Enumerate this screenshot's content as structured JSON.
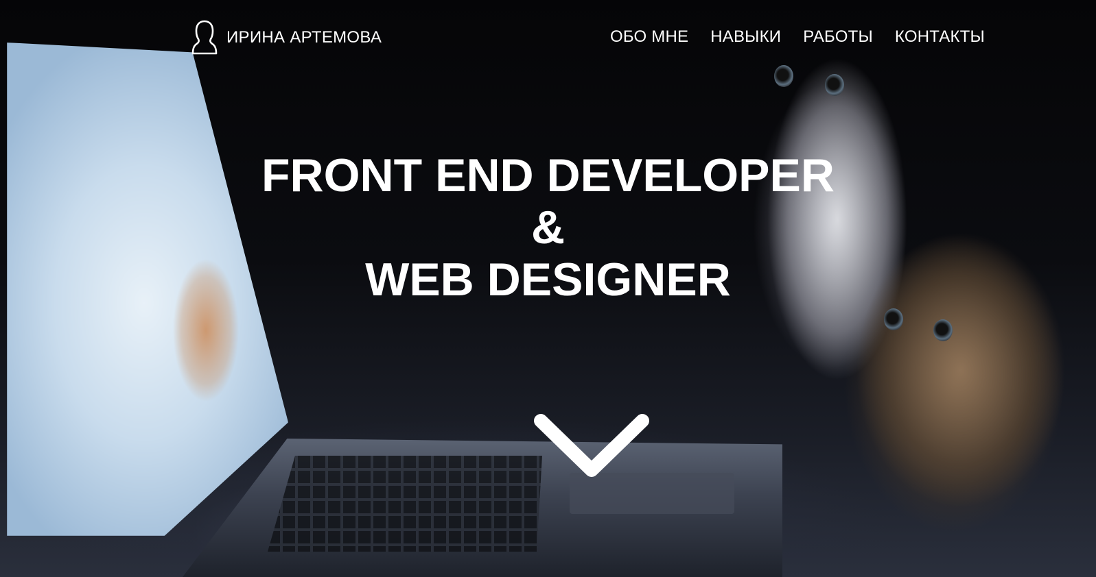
{
  "header": {
    "brand_name": "ИРИНА АРТЕМОВА",
    "brand_icon": "user-silhouette-icon",
    "nav": [
      {
        "label": "ОБО МНЕ"
      },
      {
        "label": "НАВЫКИ"
      },
      {
        "label": "РАБОТЫ"
      },
      {
        "label": "КОНТАКТЫ"
      }
    ]
  },
  "hero": {
    "line1": "FRONT END DEVELOPER",
    "line2": "&",
    "line3": "WEB DESIGNER",
    "scroll_icon": "chevron-down-icon"
  },
  "colors": {
    "text": "#ffffff",
    "background": "#000000"
  }
}
